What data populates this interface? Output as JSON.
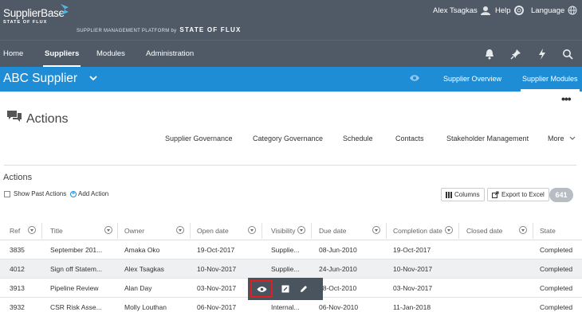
{
  "header": {
    "logo_line1": "SupplierBase",
    "logo_line2": "STATE OF FLUX",
    "tagline": "SUPPLIER MANAGEMENT PLATFORM by",
    "tagline_brand": "STATE OF FLUX",
    "user_name": "Alex Tsagkas",
    "help_label": "Help",
    "language_label": "Language"
  },
  "nav": {
    "items": [
      {
        "label": "Home"
      },
      {
        "label": "Suppliers"
      },
      {
        "label": "Modules"
      },
      {
        "label": "Administration"
      }
    ],
    "active": "Suppliers",
    "icons": [
      "bell-icon",
      "pin-icon",
      "lightning-icon",
      "search-icon"
    ]
  },
  "supplier_bar": {
    "name": "ABC Supplier",
    "overview_label": "Supplier Overview",
    "modules_label": "Supplier Modules",
    "color": "#1f8dd6"
  },
  "page": {
    "title": "Actions",
    "more_menu": "•••",
    "subnav": [
      "Supplier Governance",
      "Category Governance",
      "Schedule",
      "Contacts",
      "Stakeholder Management",
      "More"
    ]
  },
  "actions_section": {
    "title": "Actions",
    "show_past_label": "Show Past Actions",
    "add_action_label": "Add Action",
    "columns_label": "Columns",
    "export_label": "Export to Excel",
    "count": "641"
  },
  "table": {
    "headers": [
      "Ref",
      "Title",
      "Owner",
      "Open date",
      "Visibility",
      "Due date",
      "Completion date",
      "Closed date",
      "State"
    ],
    "rows": [
      [
        "3835",
        "September 201...",
        "Amaka Oko",
        "19-Oct-2017",
        "Supplie...",
        "08-Jun-2010",
        "19-Oct-2017",
        "",
        "Completed"
      ],
      [
        "4012",
        "Sign off Statem...",
        "Alex Tsagkas",
        "10-Nov-2017",
        "Supplie...",
        "24-Jun-2010",
        "10-Nov-2017",
        "",
        "Completed"
      ],
      [
        "3913",
        "Pipeline Review",
        "Alan Day",
        "03-Nov-2017",
        "",
        "08-Oct-2010",
        "03-Nov-2017",
        "",
        "Completed"
      ],
      [
        "3932",
        "CSR Risk Asse...",
        "Molly Louthan",
        "06-Nov-2017",
        "Internal...",
        "06-Nov-2010",
        "11-Jan-2018",
        "",
        "Completed"
      ]
    ]
  },
  "row_toolbar": {
    "icons": [
      "eye-icon",
      "external-edit-icon",
      "pencil-icon"
    ],
    "highlight_color": "#e02020"
  },
  "colors": {
    "header_bg": "#4f5a66",
    "accent": "#1f8dd6"
  }
}
